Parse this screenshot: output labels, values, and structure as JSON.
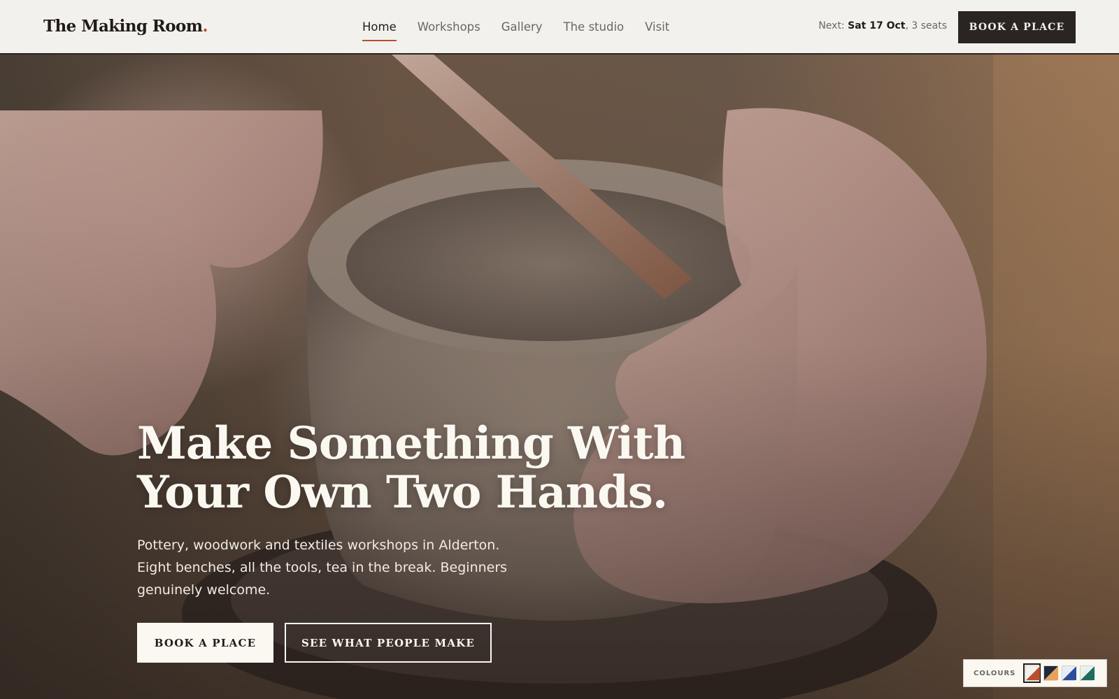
{
  "header": {
    "logo": "The Making Room",
    "logo_dot": ".",
    "nav": [
      {
        "label": "Home",
        "active": true
      },
      {
        "label": "Workshops",
        "active": false
      },
      {
        "label": "Gallery",
        "active": false
      },
      {
        "label": "The studio",
        "active": false
      },
      {
        "label": "Visit",
        "active": false
      }
    ],
    "next_prefix": "Next:",
    "next_date": "Sat 17 Oct",
    "next_seats": ", 3 seats",
    "cta_label": "Book a place"
  },
  "hero": {
    "title_line1": "Make Something With",
    "title_line2": "Your Own Two Hands.",
    "sub_line1": "Pottery, woodwork and textiles workshops in Alderton.",
    "sub_line2": "Eight benches, all the tools, tea in the break. Beginners",
    "sub_line3": "genuinely welcome.",
    "primary_cta": "Book a place",
    "secondary_cta": "See what people make",
    "image_subject": "hands shaping a clay pot on a pottery wheel"
  },
  "colours": {
    "label": "Colours",
    "swatches": [
      {
        "name": "terracotta",
        "a": "#b5512c",
        "b": "#f3f1ed",
        "selected": true
      },
      {
        "name": "navy-amber",
        "a": "#1f2a3a",
        "b": "#e8a25a",
        "selected": false
      },
      {
        "name": "blue",
        "a": "#2d4c9a",
        "b": "#e8ecf6",
        "selected": false
      },
      {
        "name": "teal",
        "a": "#1f6b5c",
        "b": "#e7f2ee",
        "selected": false
      }
    ]
  },
  "theme": {
    "accent": "#b5512c",
    "ink": "#211c19",
    "paper": "#f3f1ed"
  }
}
